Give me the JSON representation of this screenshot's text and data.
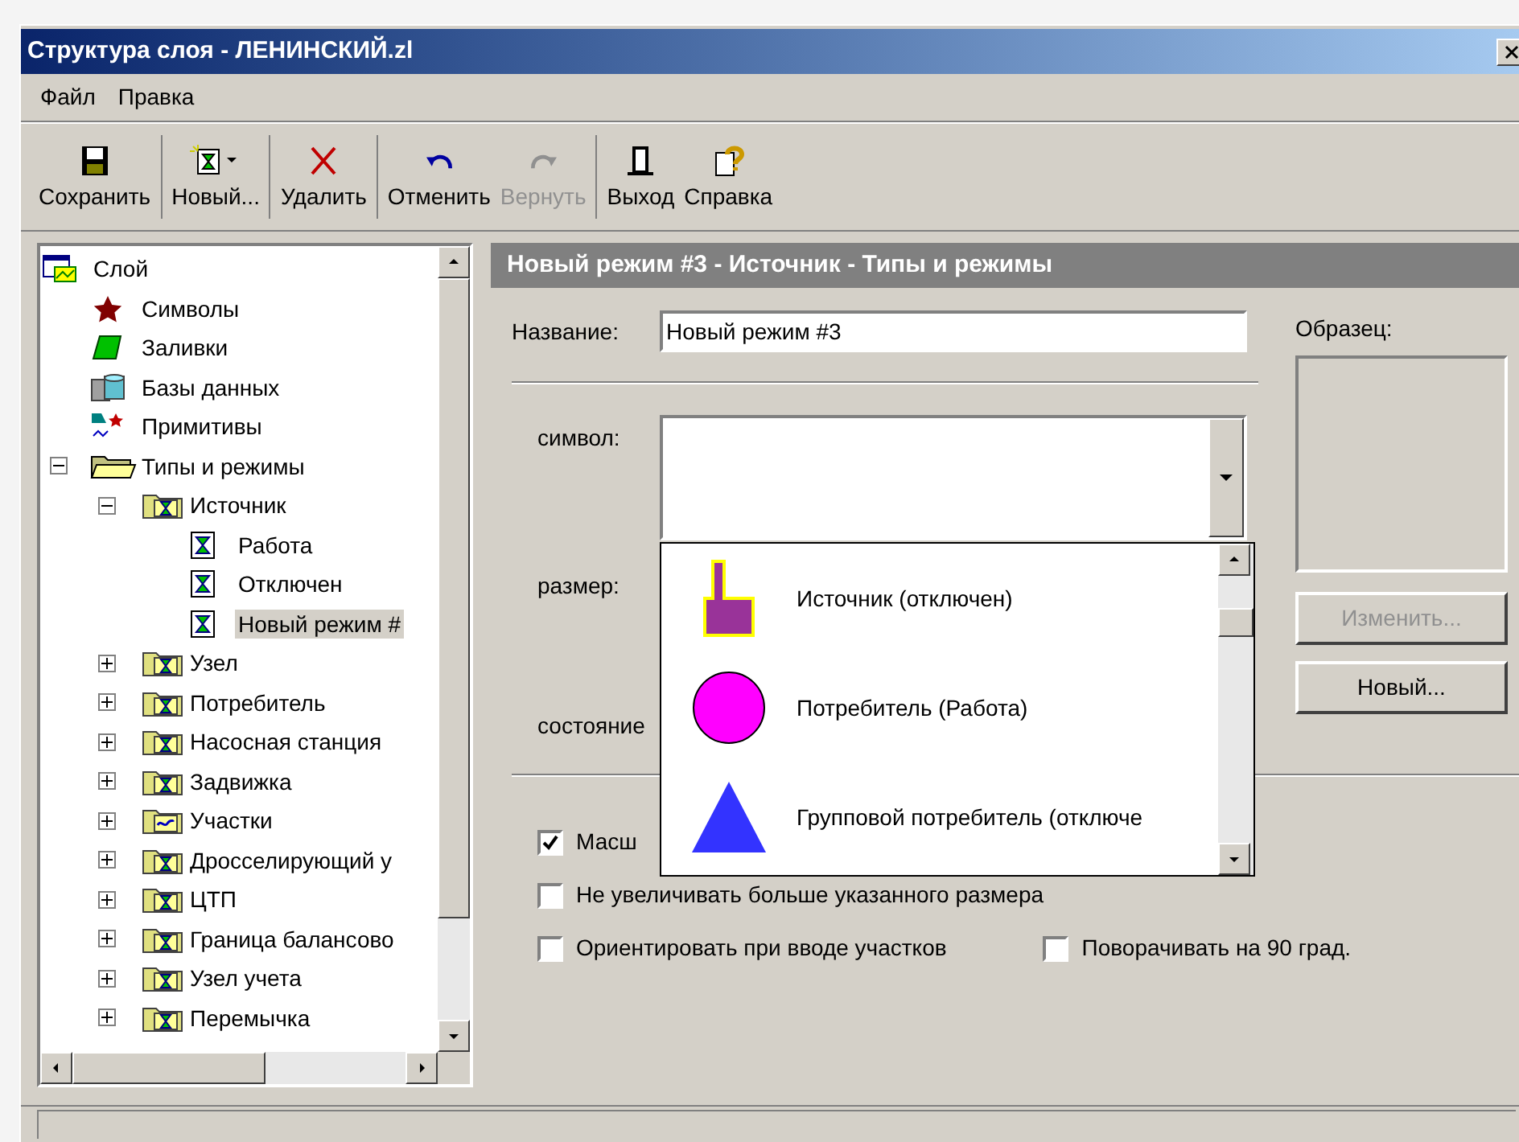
{
  "window": {
    "title": "Структура слоя - ЛЕНИНСКИЙ.zl"
  },
  "menu": [
    "Файл",
    "Правка"
  ],
  "toolbar": {
    "groups": [
      {
        "buttons": [
          {
            "label": "Сохранить",
            "kind": "save",
            "disabled": false
          }
        ]
      },
      {
        "buttons": [
          {
            "label": "Новый...",
            "kind": "new",
            "disabled": false
          }
        ]
      },
      {
        "buttons": [
          {
            "label": "Удалить",
            "kind": "delete",
            "disabled": false
          }
        ]
      },
      {
        "buttons": [
          {
            "label": "Отменить",
            "kind": "undo",
            "disabled": false
          },
          {
            "label": "Вернуть",
            "kind": "redo",
            "disabled": true
          }
        ]
      },
      {
        "buttons": [
          {
            "label": "Выход",
            "kind": "exit",
            "disabled": false
          },
          {
            "label": "Справка",
            "kind": "help",
            "disabled": false
          }
        ]
      }
    ]
  },
  "tree": {
    "label": "Слой",
    "kind": "layer",
    "selected": false,
    "children": [
      {
        "label": "Символы",
        "kind": "star",
        "selected": false
      },
      {
        "label": "Заливки",
        "kind": "fill",
        "selected": false
      },
      {
        "label": "Базы данных",
        "kind": "database",
        "selected": false
      },
      {
        "label": "Примитивы",
        "kind": "primitives",
        "selected": false
      },
      {
        "label": "Типы и режимы",
        "kind": "folder",
        "selected": false,
        "expanded": true,
        "children": [
          {
            "label": "Источник",
            "kind": "folder-mode",
            "selected": false,
            "expanded": true,
            "children": [
              {
                "label": "Работа",
                "kind": "mode",
                "selected": false
              },
              {
                "label": "Отключен",
                "kind": "mode",
                "selected": false
              },
              {
                "label": "Новый режим #",
                "kind": "mode",
                "selected": true
              }
            ]
          },
          {
            "label": "Узел",
            "kind": "folder-mode",
            "selected": false,
            "expanded": false
          },
          {
            "label": "Потребитель",
            "kind": "folder-mode",
            "selected": false,
            "expanded": false
          },
          {
            "label": "Насосная станция",
            "kind": "folder-mode",
            "selected": false,
            "expanded": false
          },
          {
            "label": "Задвижка",
            "kind": "folder-mode",
            "selected": false,
            "expanded": false
          },
          {
            "label": "Участки",
            "kind": "folder-line",
            "selected": false,
            "expanded": false
          },
          {
            "label": "Дросселирующий у",
            "kind": "folder-mode",
            "selected": false,
            "expanded": false
          },
          {
            "label": "ЦТП",
            "kind": "folder-mode",
            "selected": false,
            "expanded": false
          },
          {
            "label": "Граница балансово",
            "kind": "folder-mode",
            "selected": false,
            "expanded": false
          },
          {
            "label": "Узел учета",
            "kind": "folder-mode",
            "selected": false,
            "expanded": false
          },
          {
            "label": "Перемычка",
            "kind": "folder-mode",
            "selected": false,
            "expanded": false
          }
        ]
      }
    ]
  },
  "editor": {
    "header": "Новый режим #3 - Источник - Типы и режимы",
    "name_label": "Название:",
    "name_value": "Новый режим #3",
    "sample_label": "Образец:",
    "symbol_label": "символ:",
    "size_label": "размер:",
    "state_label": "состояние",
    "buttons": [
      {
        "label": "Изменить...",
        "disabled": true
      },
      {
        "label": "Новый...",
        "disabled": false
      }
    ],
    "symbol_dropdown": {
      "expanded": true,
      "options": [
        {
          "label": "Источник (отключен)",
          "kind": "source",
          "color": "#993399"
        },
        {
          "label": "Потребитель (Работа)",
          "kind": "circle",
          "color": "#ff00ff"
        },
        {
          "label": "Групповой потребитель (отключе",
          "kind": "triangle",
          "color": "#3333ff"
        }
      ]
    },
    "checkbox_rows": [
      [
        {
          "label": "Масш",
          "checked": true
        }
      ],
      [
        {
          "label": "Не увеличивать больше указанного размера",
          "checked": false
        }
      ],
      [
        {
          "label": "Ориентировать при вводе участков",
          "checked": false
        },
        {
          "label": "Поворачивать на 90 град.",
          "checked": false
        }
      ]
    ]
  }
}
